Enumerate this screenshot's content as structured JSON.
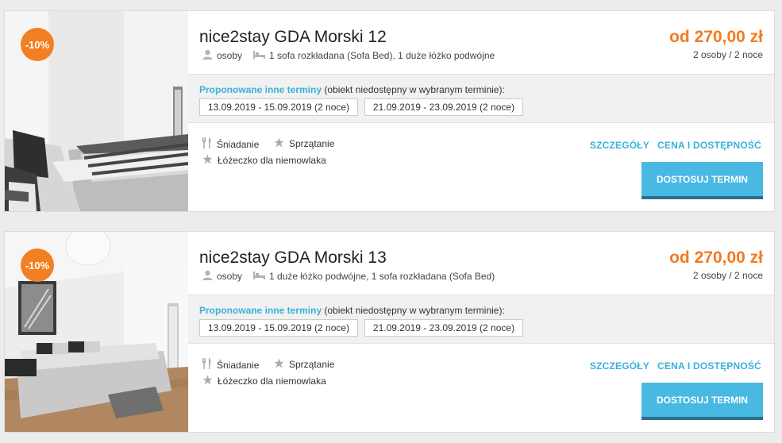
{
  "listings": [
    {
      "discount": "-10%",
      "title": "nice2stay GDA Morski 12",
      "guests_label": "osoby",
      "beds": "1 sofa rozkładana (Sofa Bed), 1 duże łóżko podwójne",
      "price": "od 270,00 zł",
      "price_sub": "2 osoby / 2 noce",
      "alt_link": "Proponowane inne terminy",
      "alt_note": " (obiekt niedostępny w wybranym terminie):",
      "dates": [
        "13.09.2019 - 15.09.2019 (2 noce)",
        "21.09.2019 - 23.09.2019 (2 noce)"
      ],
      "amenities": [
        "Śniadanie",
        "Sprzątanie",
        "Łóżeczko dla niemowlaka"
      ],
      "details_link": "SZCZEGÓŁY",
      "availability_link": "CENA I DOSTĘPNOŚĆ",
      "cta": "DOSTOSUJ TERMIN"
    },
    {
      "discount": "-10%",
      "title": "nice2stay GDA Morski 13",
      "guests_label": "osoby",
      "beds": "1 duże łóżko podwójne, 1 sofa rozkładana (Sofa Bed)",
      "price": "od 270,00 zł",
      "price_sub": "2 osoby / 2 noce",
      "alt_link": "Proponowane inne terminy",
      "alt_note": " (obiekt niedostępny w wybranym terminie):",
      "dates": [
        "13.09.2019 - 15.09.2019 (2 noce)",
        "21.09.2019 - 23.09.2019 (2 noce)"
      ],
      "amenities": [
        "Śniadanie",
        "Sprzątanie",
        "Łóżeczko dla niemowlaka"
      ],
      "details_link": "SZCZEGÓŁY",
      "availability_link": "CENA I DOSTĘPNOŚĆ",
      "cta": "DOSTOSUJ TERMIN"
    }
  ],
  "icons": {
    "guests": "person-icon",
    "beds": "bed-icon",
    "breakfast": "cutlery-icon",
    "amenity": "star-icon"
  },
  "colors": {
    "price": "#f47a20",
    "discount": "#f28023",
    "link": "#3ab0dc",
    "cta": "#47b9e3"
  }
}
